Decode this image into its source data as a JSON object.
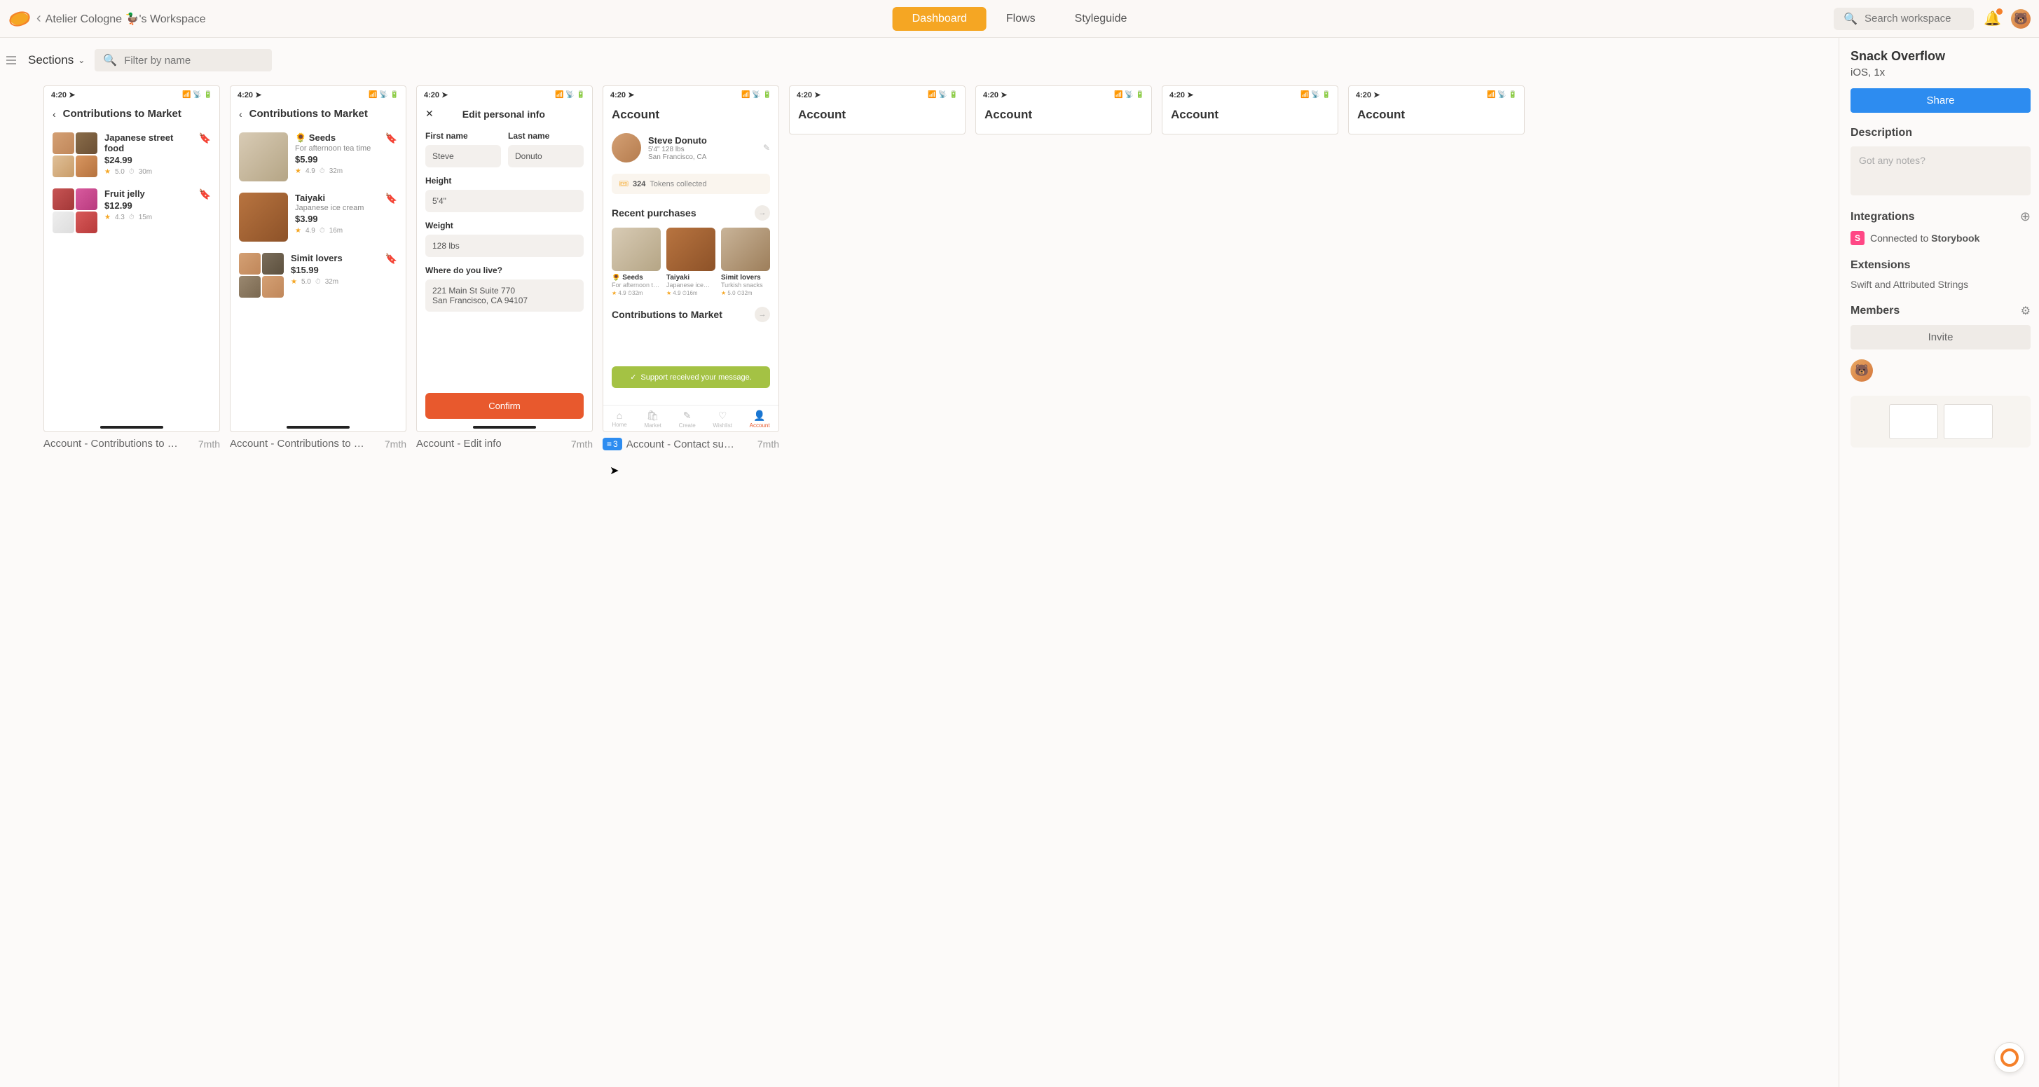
{
  "header": {
    "workspace": "Atelier Cologne 🦆's Workspace",
    "tabs": {
      "dashboard": "Dashboard",
      "flows": "Flows",
      "styleguide": "Styleguide"
    },
    "search_placeholder": "Search workspace"
  },
  "toolbar": {
    "sections": "Sections",
    "filter_placeholder": "Filter by name"
  },
  "status_time": "4:20",
  "screens": {
    "s1": {
      "title": "Contributions to Market",
      "items": [
        {
          "name": "Japanese street food",
          "price": "$24.99",
          "rating": "5.0",
          "time": "30m"
        },
        {
          "name": "Fruit jelly",
          "price": "$12.99",
          "rating": "4.3",
          "time": "15m"
        }
      ],
      "label": "Account - Contributions to …",
      "age": "7mth"
    },
    "s2": {
      "title": "Contributions to Market",
      "items": [
        {
          "name": "🌻 Seeds",
          "sub": "For afternoon tea time",
          "price": "$5.99",
          "rating": "4.9",
          "time": "32m"
        },
        {
          "name": "Taiyaki",
          "sub": "Japanese ice cream",
          "price": "$3.99",
          "rating": "4.9",
          "time": "16m"
        },
        {
          "name": "Simit lovers",
          "price": "$15.99",
          "rating": "5.0",
          "time": "32m"
        }
      ],
      "label": "Account - Contributions to …",
      "age": "7mth"
    },
    "s3": {
      "title": "Edit personal info",
      "labels": {
        "first": "First name",
        "last": "Last name",
        "height": "Height",
        "weight": "Weight",
        "where": "Where do you live?"
      },
      "values": {
        "first": "Steve",
        "last": "Donuto",
        "height": "5'4\"",
        "weight": "128 lbs",
        "addr1": "221 Main St Suite 770",
        "addr2": "San Francisco, CA 94107"
      },
      "confirm": "Confirm",
      "label": "Account - Edit info",
      "age": "7mth"
    },
    "s4": {
      "title": "Account",
      "profile": {
        "name": "Steve Donuto",
        "stats": "5'4\"  128 lbs",
        "loc": "San Francisco, CA"
      },
      "tokens_count": "324",
      "tokens_label": "Tokens collected",
      "recent_title": "Recent purchases",
      "cards": [
        {
          "name": "🌻 Seeds",
          "sub": "For afternoon t…",
          "rating": "4.9",
          "time": "32m"
        },
        {
          "name": "Taiyaki",
          "sub": "Japanese ice…",
          "rating": "4.9",
          "time": "16m"
        },
        {
          "name": "Simit lovers",
          "sub": "Turkish snacks",
          "rating": "5.0",
          "time": "32m"
        }
      ],
      "contrib_title": "Contributions to Market",
      "toast": "Support received your message.",
      "tabs": {
        "home": "Home",
        "market": "Market",
        "create": "Create",
        "wishlist": "Wishlist",
        "account": "Account"
      },
      "layers": "3",
      "label": "Account - Contact su…",
      "age": "7mth"
    },
    "row2_title": "Account"
  },
  "right": {
    "title": "Snack Overflow",
    "sub": "iOS, 1x",
    "share": "Share",
    "description": "Description",
    "notes_placeholder": "Got any notes?",
    "integrations": "Integrations",
    "connected": "Connected to ",
    "storybook": "Storybook",
    "extensions": "Extensions",
    "ext_item": "Swift and Attributed Strings",
    "members": "Members",
    "invite": "Invite"
  }
}
